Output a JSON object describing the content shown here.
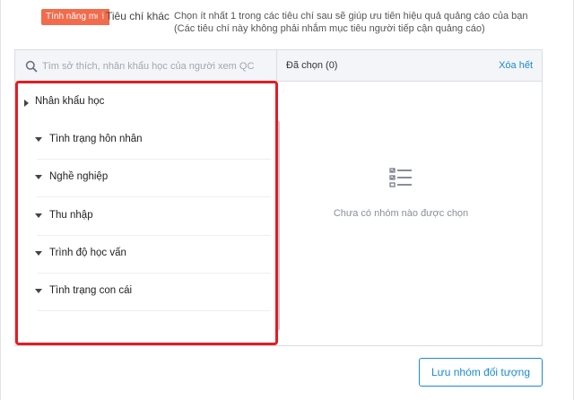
{
  "header": {
    "badge": "Tính năng mới",
    "criteria_title": "Tiêu chí khác",
    "description_line1": "Chọn ít nhất 1 trong các tiêu chí sau sẽ giúp ưu tiên hiệu quả quảng cáo của bạn",
    "description_line2": "(Các tiêu chí này không phải nhắm mục tiêu người tiếp cận quảng cáo)"
  },
  "search": {
    "placeholder": "Tìm sở thích, nhân khẩu học của người xem QC",
    "value": ""
  },
  "selected_panel": {
    "label": "Đã chọn (0)",
    "clear_all": "Xóa hết",
    "empty_text": "Chưa có nhóm nào được chọn",
    "empty_icon": "checklist-icon"
  },
  "list": {
    "category": "Nhân khẩu học",
    "items": [
      {
        "label": "Tình trạng hôn nhân"
      },
      {
        "label": "Nghề nghiệp"
      },
      {
        "label": "Thu nhập"
      },
      {
        "label": "Trình độ học vấn"
      },
      {
        "label": "Tình trạng con cái"
      }
    ]
  },
  "footer": {
    "save_label": "Lưu nhóm đối tượng"
  },
  "colors": {
    "badge": "#f26b4c",
    "accent": "#1a8ad3",
    "highlight": "#e31c24"
  }
}
